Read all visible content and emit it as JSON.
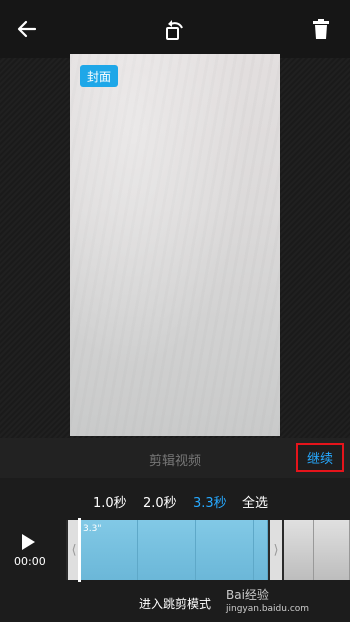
{
  "header": {
    "back_icon": "arrow-left-icon",
    "rotate_icon": "rotate-icon",
    "delete_icon": "trash-icon"
  },
  "preview": {
    "cover_label": "封面"
  },
  "edit": {
    "title": "剪辑视频",
    "continue_label": "继续"
  },
  "speed_options": [
    {
      "label": "1.0秒",
      "active": false
    },
    {
      "label": "2.0秒",
      "active": false
    },
    {
      "label": "3.3秒",
      "active": true
    },
    {
      "label": "全选",
      "active": false
    }
  ],
  "player": {
    "time": "00:00",
    "segment_label": "3.3\""
  },
  "footer": {
    "jump_mode_label": "进入跳剪模式"
  },
  "watermark": {
    "brand": "Bai经验",
    "url": "jingyan.baidu.com"
  },
  "colors": {
    "accent": "#27a9ff",
    "highlight_border": "#e5141b",
    "badge": "#1ea7e8"
  }
}
